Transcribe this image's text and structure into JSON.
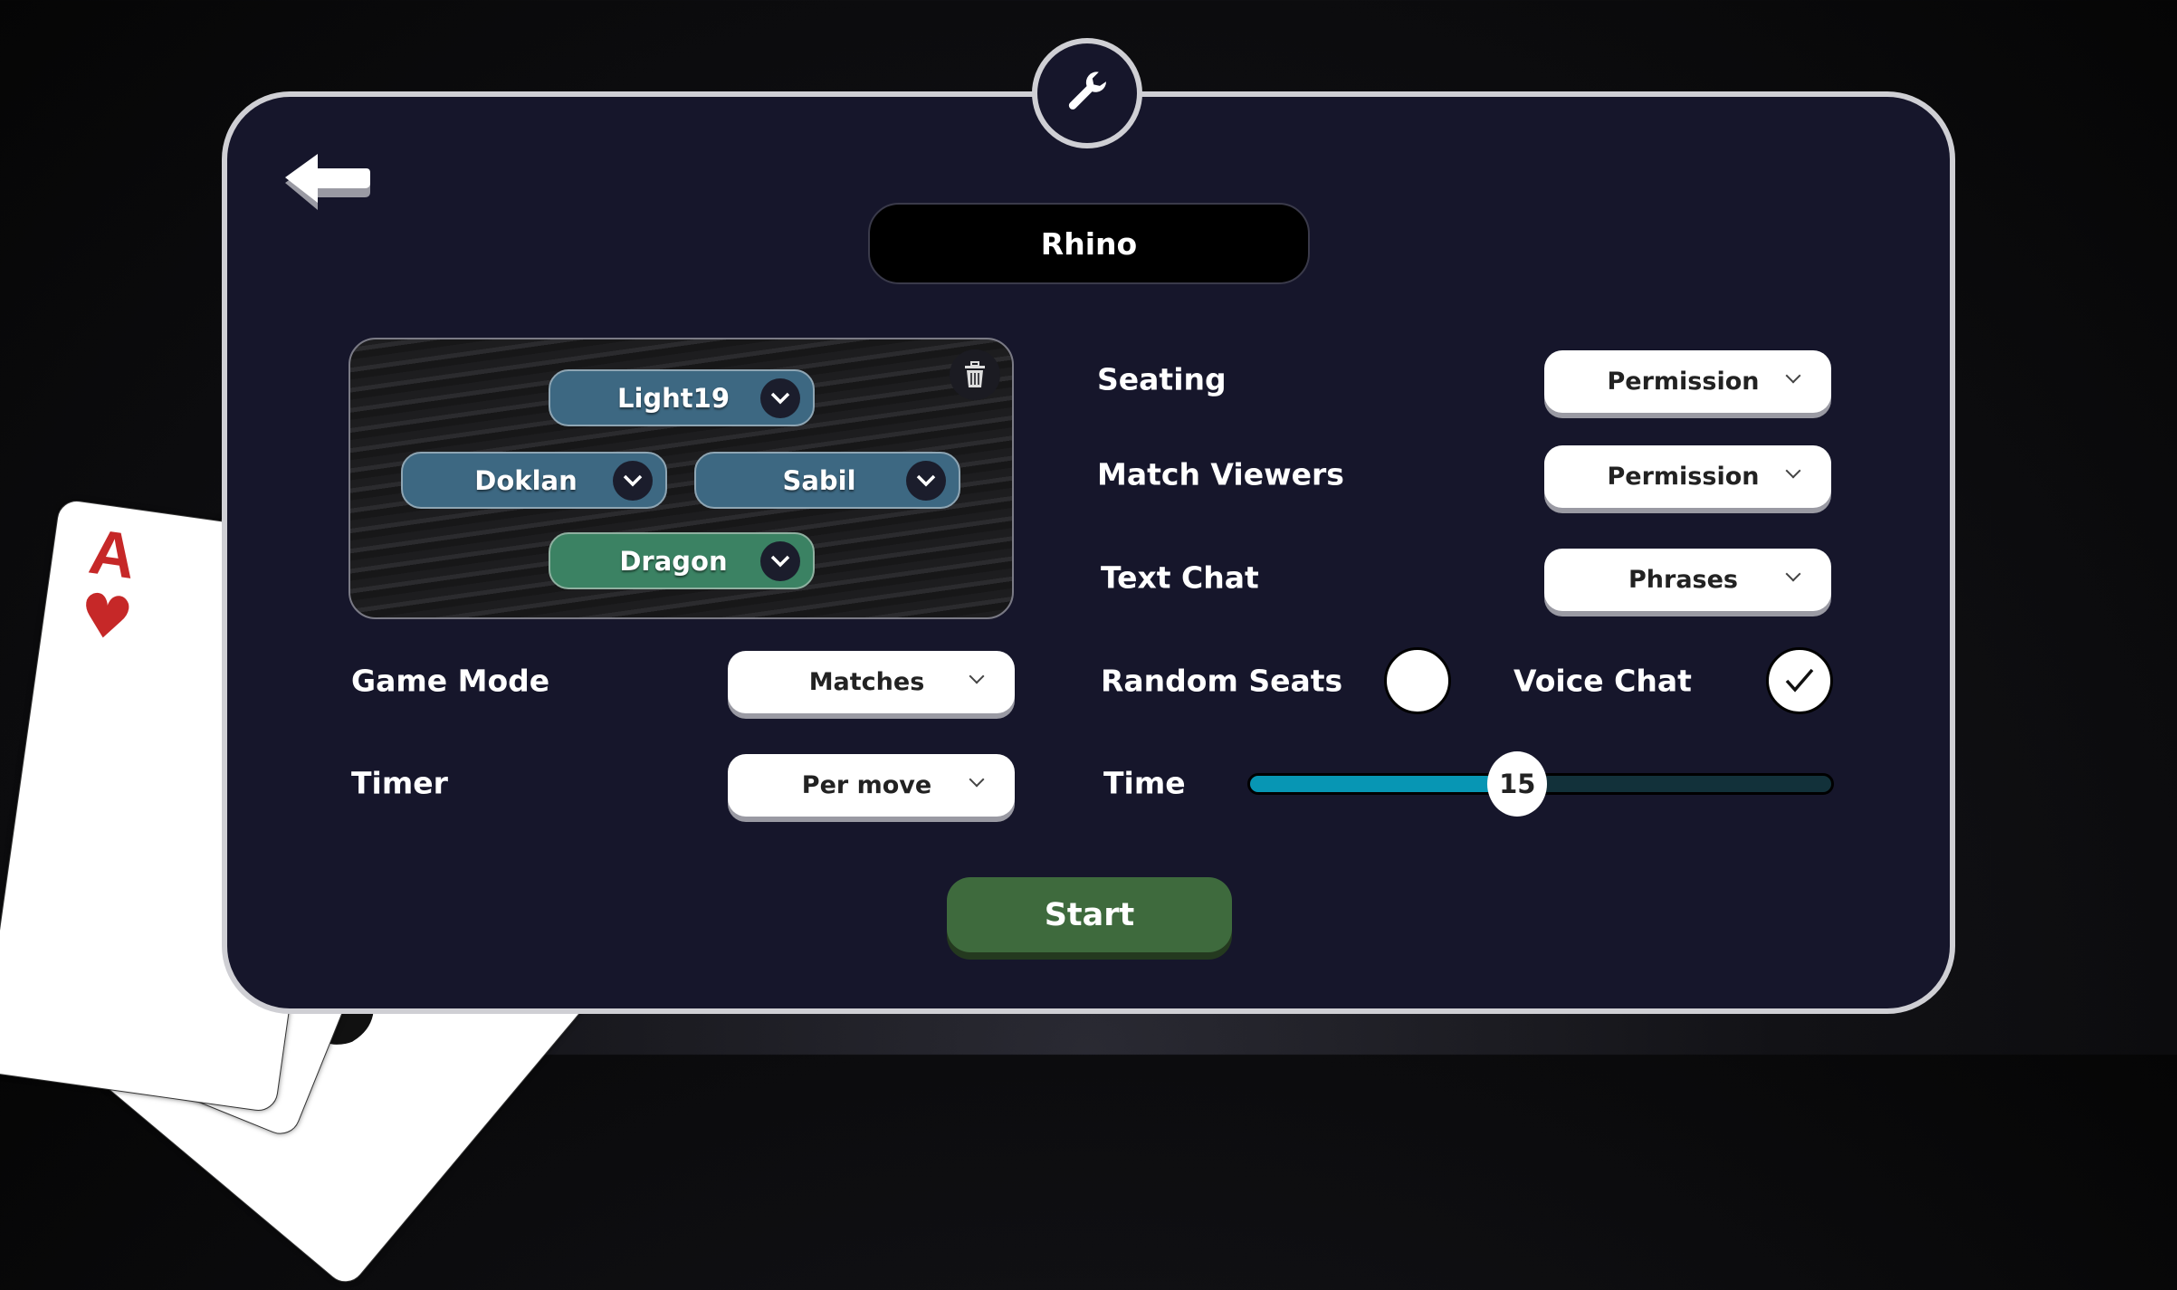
{
  "lobby_name": "Rhino",
  "seats": [
    {
      "player": "Light19",
      "team_color": "#3d6882"
    },
    {
      "player": "Doklan",
      "team_color": "#3d6882"
    },
    {
      "player": "Sabil",
      "team_color": "#3d6882"
    },
    {
      "player": "Dragon",
      "team_color": "#3b8263"
    }
  ],
  "settings": {
    "game_mode": {
      "label": "Game Mode",
      "value": "Matches"
    },
    "timer": {
      "label": "Timer",
      "value": "Per move"
    },
    "seating": {
      "label": "Seating",
      "value": "Permission"
    },
    "match_viewers": {
      "label": "Match Viewers",
      "value": "Permission"
    },
    "text_chat": {
      "label": "Text Chat",
      "value": "Phrases"
    },
    "random_seats": {
      "label": "Random Seats",
      "checked": false
    },
    "voice_chat": {
      "label": "Voice Chat",
      "checked": true
    },
    "time": {
      "label": "Time",
      "value": "15",
      "fill_percent": 46
    }
  },
  "start_label": "Start",
  "cards": [
    {
      "rank": "A",
      "suit": "hearts",
      "color": "#c62828"
    },
    {
      "rank": "A",
      "suit": "spades",
      "color": "#111111"
    }
  ],
  "colors": {
    "panel": "#16162b",
    "accent": "#0796b4",
    "start": "#3e6a3d"
  }
}
